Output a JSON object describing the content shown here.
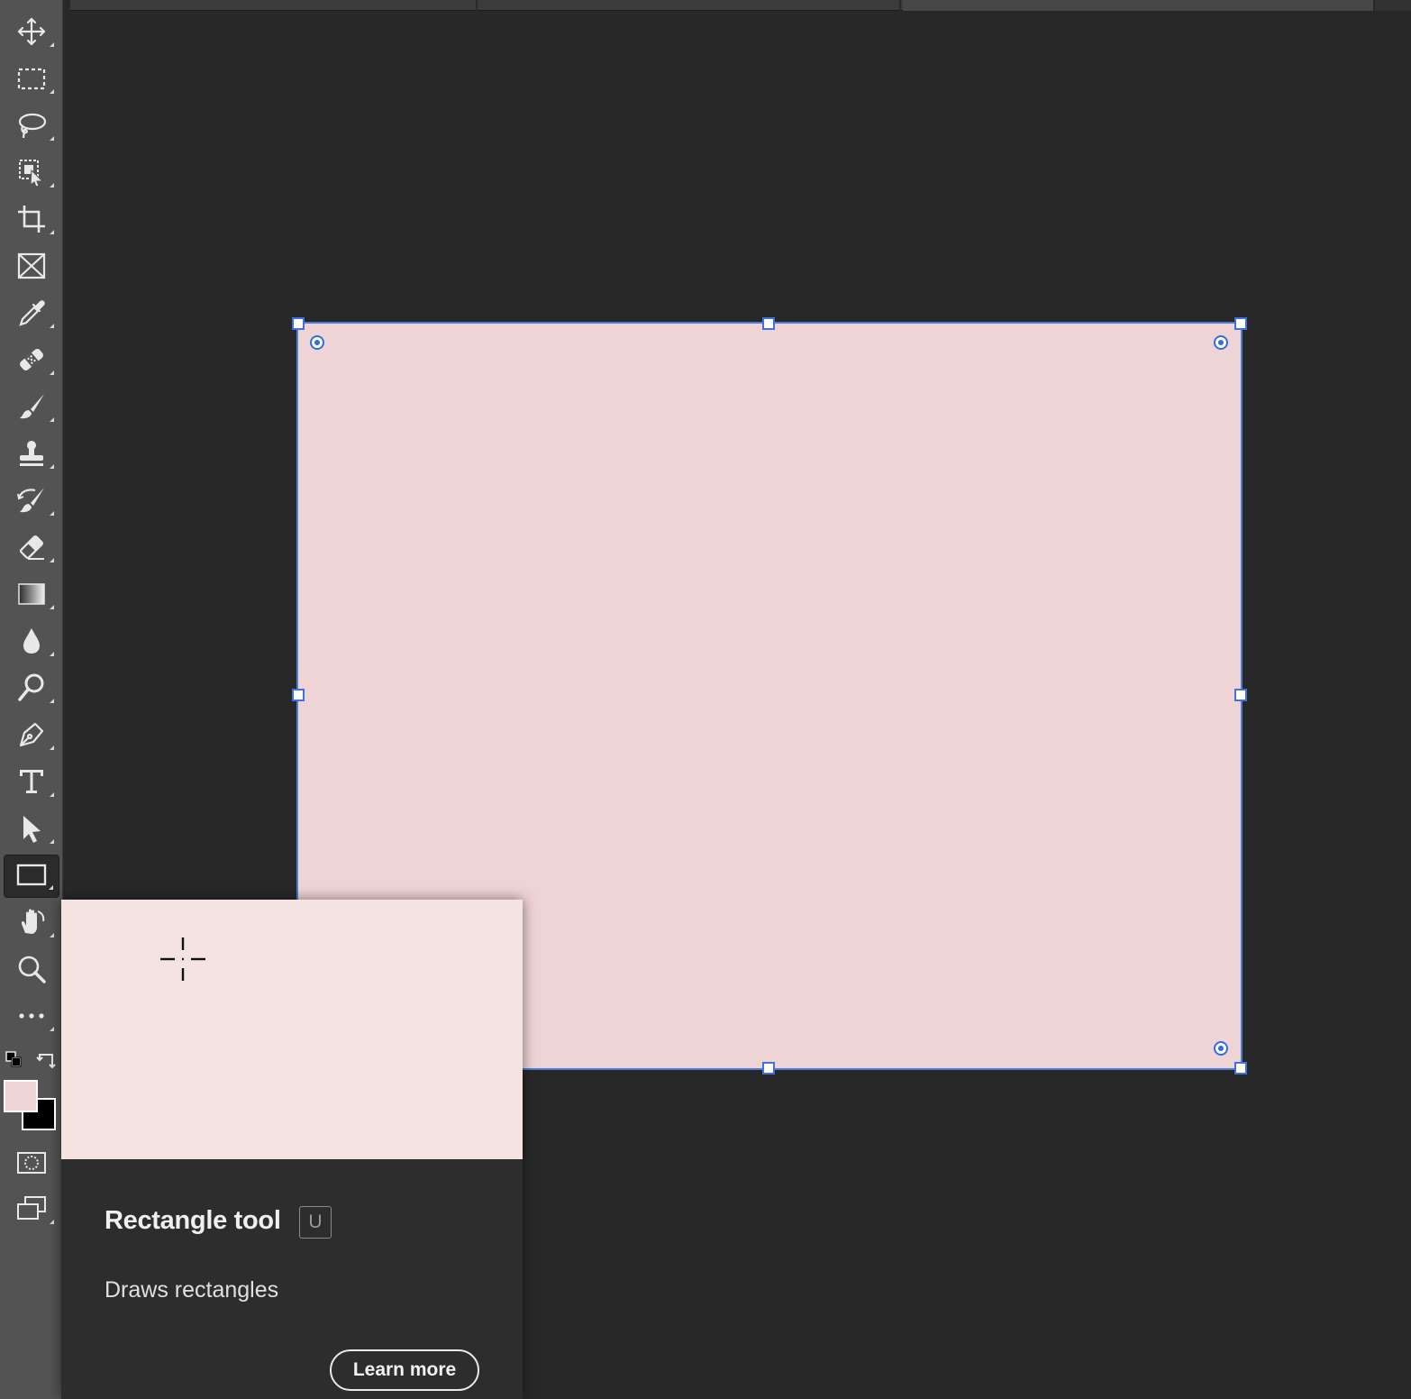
{
  "toolbar": {
    "tools": [
      {
        "name": "move-tool",
        "icon": "move-icon"
      },
      {
        "name": "marquee-tool",
        "icon": "rectangular-marquee-icon"
      },
      {
        "name": "lasso-tool",
        "icon": "lasso-icon"
      },
      {
        "name": "object-selection-tool",
        "icon": "object-selection-icon"
      },
      {
        "name": "crop-tool",
        "icon": "crop-icon"
      },
      {
        "name": "frame-tool",
        "icon": "frame-icon"
      },
      {
        "name": "eyedropper-tool",
        "icon": "eyedropper-icon"
      },
      {
        "name": "healing-tool",
        "icon": "bandage-icon"
      },
      {
        "name": "brush-tool",
        "icon": "brush-icon"
      },
      {
        "name": "clone-stamp-tool",
        "icon": "stamp-icon"
      },
      {
        "name": "history-brush-tool",
        "icon": "history-brush-icon"
      },
      {
        "name": "eraser-tool",
        "icon": "eraser-icon"
      },
      {
        "name": "gradient-tool",
        "icon": "gradient-icon"
      },
      {
        "name": "blur-tool",
        "icon": "drop-icon"
      },
      {
        "name": "dodge-tool",
        "icon": "dodge-icon"
      },
      {
        "name": "pen-tool",
        "icon": "pen-icon"
      },
      {
        "name": "type-tool",
        "icon": "type-icon"
      },
      {
        "name": "path-selection-tool",
        "icon": "arrow-icon"
      },
      {
        "name": "rectangle-tool",
        "icon": "rectangle-icon",
        "active": true
      },
      {
        "name": "hand-tool",
        "icon": "hand-icon"
      },
      {
        "name": "zoom-tool",
        "icon": "zoom-icon"
      },
      {
        "name": "more-tools",
        "icon": "more-icon"
      }
    ],
    "foreground_color": "#efd4d5",
    "background_color": "#000000"
  },
  "canvas": {
    "background": "#282828",
    "shape_fill": "#efd4d5",
    "selection_color": "#3f72dd"
  },
  "tooltip": {
    "title": "Rectangle tool",
    "shortcut": "U",
    "description": "Draws rectangles",
    "learn_more_label": "Learn more",
    "preview_color": "#f5e3e2"
  }
}
